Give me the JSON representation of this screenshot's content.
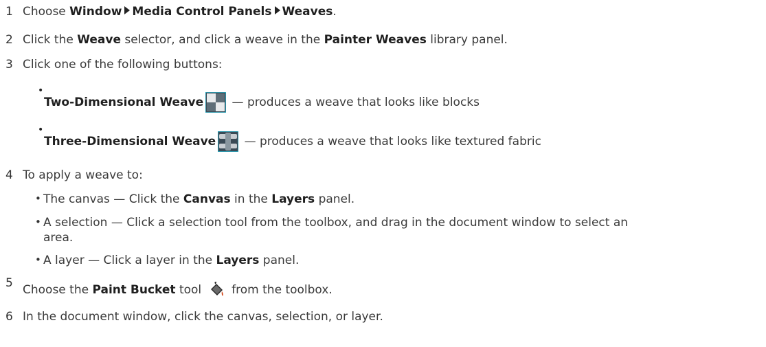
{
  "steps": [
    {
      "num": "1",
      "t1": "Choose ",
      "w1": "Window",
      "w2": "Media Control Panels",
      "w3": "Weaves",
      "t2": "."
    },
    {
      "num": "2",
      "t1": "Click the ",
      "b1": "Weave",
      "t2": " selector, and click a weave in the ",
      "b2": "Painter Weaves",
      "t3": " library panel."
    },
    {
      "num": "3",
      "t1": "Click one of the following buttons:"
    },
    {
      "num": "4",
      "t1": "To apply a weave to:"
    },
    {
      "num": "5",
      "t1": "Choose the ",
      "b1": "Paint Bucket",
      "t2": " tool",
      "t3": "from the toolbox."
    },
    {
      "num": "6",
      "t1": "In the document window, click the canvas, selection, or layer."
    }
  ],
  "buttons": [
    {
      "label": "Two-Dimensional Weave",
      "desc": " — produces a weave that looks like blocks"
    },
    {
      "label": "Three-Dimensional Weave",
      "desc": " — produces a weave that looks like textured fabric"
    }
  ],
  "apply": [
    {
      "t1": "The canvas — Click the ",
      "b1": "Canvas",
      "t2": " in the ",
      "b2": "Layers",
      "t3": " panel."
    },
    {
      "t1": "A selection — Click a selection tool from the toolbox, and drag in the document window to select an",
      "t2": "area."
    },
    {
      "t1": "A layer — Click a layer in the ",
      "b1": "Layers",
      "t2": " panel."
    }
  ],
  "icons": [
    "two-dimensional-weave-icon",
    "three-dimensional-weave-icon",
    "paint-bucket-icon",
    "menu-arrow-icon"
  ]
}
